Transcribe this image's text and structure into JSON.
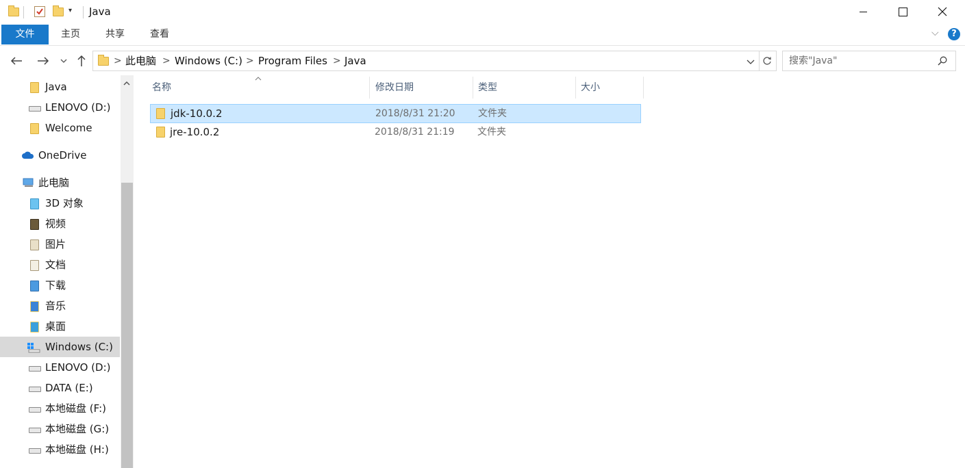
{
  "window": {
    "title": "Java",
    "minimize_label": "─",
    "maximize_label": "☐",
    "close_label": "✕"
  },
  "ribbon": {
    "tabs": [
      "文件",
      "主页",
      "共享",
      "查看"
    ],
    "help_label": "?",
    "expand_label": "⌵"
  },
  "address": {
    "crumbs": [
      "此电脑",
      "Windows (C:)",
      "Program Files",
      "Java"
    ],
    "separator": ">",
    "search_placeholder": "搜索\"Java\""
  },
  "sidebar": {
    "items": [
      {
        "label": "Java",
        "icon": "folder-icon"
      },
      {
        "label": "LENOVO (D:)",
        "icon": "drive-icon"
      },
      {
        "label": "Welcome",
        "icon": "folder-icon"
      },
      {
        "label": "OneDrive",
        "icon": "cloud-icon"
      },
      {
        "label": "此电脑",
        "icon": "computer-icon"
      },
      {
        "label": "3D 对象",
        "icon": "folder-3d-icon"
      },
      {
        "label": "视频",
        "icon": "folder-video-icon"
      },
      {
        "label": "图片",
        "icon": "folder-pictures-icon"
      },
      {
        "label": "文档",
        "icon": "folder-documents-icon"
      },
      {
        "label": "下载",
        "icon": "folder-downloads-icon"
      },
      {
        "label": "音乐",
        "icon": "folder-music-icon"
      },
      {
        "label": "桌面",
        "icon": "folder-desktop-icon"
      },
      {
        "label": "Windows (C:)",
        "icon": "windows-drive-icon"
      },
      {
        "label": "LENOVO (D:)",
        "icon": "drive-icon"
      },
      {
        "label": "DATA (E:)",
        "icon": "drive-icon"
      },
      {
        "label": "本地磁盘 (F:)",
        "icon": "drive-icon"
      },
      {
        "label": "本地磁盘 (G:)",
        "icon": "drive-icon"
      },
      {
        "label": "本地磁盘 (H:)",
        "icon": "drive-icon"
      }
    ]
  },
  "files": {
    "columns": [
      "名称",
      "修改日期",
      "类型",
      "大小"
    ],
    "rows": [
      {
        "name": "jdk-10.0.2",
        "date": "2018/8/31 21:20",
        "type": "文件夹",
        "size": "",
        "selected": true
      },
      {
        "name": "jre-10.0.2",
        "date": "2018/8/31 21:19",
        "type": "文件夹",
        "size": "",
        "selected": false
      }
    ]
  },
  "colors": {
    "file_tab": "#1979ca",
    "selection_fill": "#cce8ff",
    "selection_border": "#99d1ff",
    "folder_yellow": "#f7d26b"
  }
}
